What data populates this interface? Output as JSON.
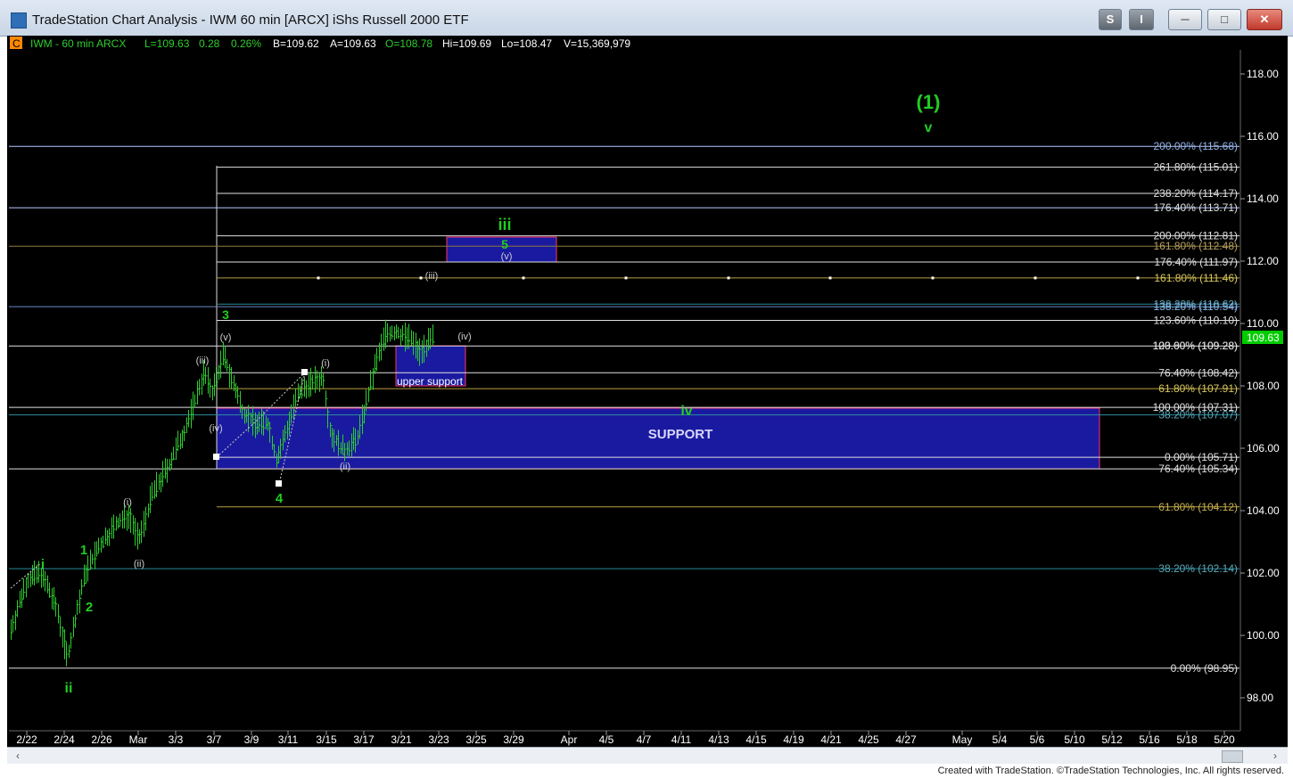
{
  "window": {
    "title": "TradeStation Chart Analysis - IWM 60 min [ARCX] iShs Russell 2000 ETF",
    "btn_s": "S",
    "btn_i": "I"
  },
  "status": {
    "c_label": "C",
    "symbol": "IWM - 60 min  ARCX",
    "last": "L=109.63",
    "change": "0.28",
    "pct": "0.26%",
    "bid": "B=109.62",
    "ask": "A=109.63",
    "open": "O=108.78",
    "high": "Hi=109.69",
    "low": "Lo=108.47",
    "volume": "V=15,369,979"
  },
  "price_axis": {
    "ticks": [
      "118.00",
      "116.00",
      "114.00",
      "112.00",
      "110.00",
      "108.00",
      "106.00",
      "104.00",
      "102.00",
      "100.00",
      "98.00"
    ],
    "current": "109.63"
  },
  "time_axis": {
    "ticks": [
      "2/22",
      "2/24",
      "2/26",
      "Mar",
      "3/3",
      "3/7",
      "3/9",
      "3/11",
      "3/15",
      "3/17",
      "3/21",
      "3/23",
      "3/25",
      "3/29",
      "Apr",
      "4/5",
      "4/7",
      "4/11",
      "4/13",
      "4/15",
      "4/19",
      "4/21",
      "4/25",
      "4/27",
      "May",
      "5/4",
      "5/6",
      "5/10",
      "5/12",
      "5/16",
      "5/18",
      "5/20"
    ]
  },
  "fib_labels": [
    {
      "text": "200.00% (115.68)",
      "price": 115.68,
      "color": "#8fb4e8"
    },
    {
      "text": "261.80% (115.01)",
      "price": 115.01,
      "color": "#e0e0e0"
    },
    {
      "text": "238.20% (114.17)",
      "price": 114.17,
      "color": "#e0e0e0"
    },
    {
      "text": "176.40% (113.71)",
      "price": 113.71,
      "color": "#e0e0e0"
    },
    {
      "text": "200.00% (112.81)",
      "price": 112.81,
      "color": "#e0e0e0"
    },
    {
      "text": "161.80% (112.48)",
      "price": 112.48,
      "color": "#b8a060"
    },
    {
      "text": "176.40% (111.97)",
      "price": 111.97,
      "color": "#e0e0e0"
    },
    {
      "text": "161.80% (111.46)",
      "price": 111.46,
      "color": "#d8c860"
    },
    {
      "text": "138.20% (110.62)",
      "price": 110.62,
      "color": "#5aa8b8"
    },
    {
      "text": "138.20% (110.54)",
      "price": 110.54,
      "color": "#8fb4e8"
    },
    {
      "text": "123.60% (110.10)",
      "price": 110.1,
      "color": "#e0e0e0"
    },
    {
      "text": "100.00% (109.28)",
      "price": 109.28,
      "color": "#e0e0e0"
    },
    {
      "text": "123.60% (109.28)",
      "price": 109.28,
      "color": "#e0e0e0"
    },
    {
      "text": "76.40% (108.42)",
      "price": 108.42,
      "color": "#e0e0e0"
    },
    {
      "text": "61.80% (107.91)",
      "price": 107.91,
      "color": "#d8c860"
    },
    {
      "text": "100.00% (107.31)",
      "price": 107.31,
      "color": "#e0e0e0"
    },
    {
      "text": "38.20% (107.07)",
      "price": 107.07,
      "color": "#5aa8b8"
    },
    {
      "text": "0.00% (105.71)",
      "price": 105.71,
      "color": "#e0e0e0"
    },
    {
      "text": "76.40% (105.34)",
      "price": 105.34,
      "color": "#e0e0e0"
    },
    {
      "text": "61.80% (104.12)",
      "price": 104.12,
      "color": "#c8b050"
    },
    {
      "text": "38.20% (102.14)",
      "price": 102.14,
      "color": "#5aa8b8"
    },
    {
      "text": "0.00% (98.95)",
      "price": 98.95,
      "color": "#e0e0e0"
    }
  ],
  "wave_labels": [
    {
      "text": "(1)",
      "color": "#22cc22"
    },
    {
      "text": "v",
      "color": "#22cc22"
    },
    {
      "text": "iii",
      "color": "#22cc22"
    },
    {
      "text": "5",
      "color": "#22cc22"
    },
    {
      "text": "(v)",
      "color": "#cfcfcf"
    },
    {
      "text": "(iii)",
      "color": "#cfcfcf"
    },
    {
      "text": "3",
      "color": "#22cc22"
    },
    {
      "text": "(v)",
      "color": "#cfcfcf"
    },
    {
      "text": "(iii)",
      "color": "#cfcfcf"
    },
    {
      "text": "(iv)",
      "color": "#cfcfcf"
    },
    {
      "text": "(i)",
      "color": "#cfcfcf"
    },
    {
      "text": "(iv)",
      "color": "#cfcfcf"
    },
    {
      "text": "(ii)",
      "color": "#cfcfcf"
    },
    {
      "text": "4",
      "color": "#22cc22"
    },
    {
      "text": "iv",
      "color": "#22cc22"
    },
    {
      "text": "(i)",
      "color": "#cfcfcf"
    },
    {
      "text": "(ii)",
      "color": "#cfcfcf"
    },
    {
      "text": "1",
      "color": "#22cc22"
    },
    {
      "text": "i",
      "color": "#22cc22"
    },
    {
      "text": "2",
      "color": "#22cc22"
    },
    {
      "text": "ii",
      "color": "#22cc22"
    }
  ],
  "boxes": {
    "support": "SUPPORT",
    "upper_support": "upper support"
  },
  "colors": {
    "background": "#000000",
    "bars": "#2ecc2e",
    "support_fill": "#1a1aa0",
    "support_border": "#ff3366",
    "current_price_bg": "#00cc00"
  },
  "footer": "Created with TradeStation. ©TradeStation Technologies, Inc. All rights reserved."
}
